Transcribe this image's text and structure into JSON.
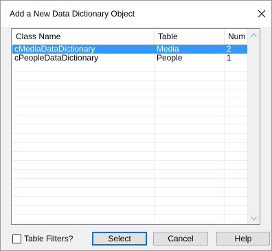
{
  "window": {
    "title": "Add a New Data Dictionary Object"
  },
  "icons": {
    "close": "close-icon",
    "scroll_up": "scroll-up-icon",
    "scroll_down": "scroll-down-icon"
  },
  "list": {
    "columns": [
      "Class Name",
      "Table",
      "Num"
    ],
    "rows": [
      {
        "class_name": "cMediaDataDictionary",
        "table": "Media",
        "num": "2",
        "selected": true
      },
      {
        "class_name": "cPeopleDataDictionary",
        "table": "People",
        "num": "1",
        "selected": false
      }
    ]
  },
  "footer": {
    "table_filters_label": "Table Filters?",
    "table_filters_checked": false,
    "select_label": "Select",
    "cancel_label": "Cancel",
    "help_label": "Help"
  },
  "colors": {
    "selection": "#3399ff",
    "default_button_border": "#0078d7"
  }
}
